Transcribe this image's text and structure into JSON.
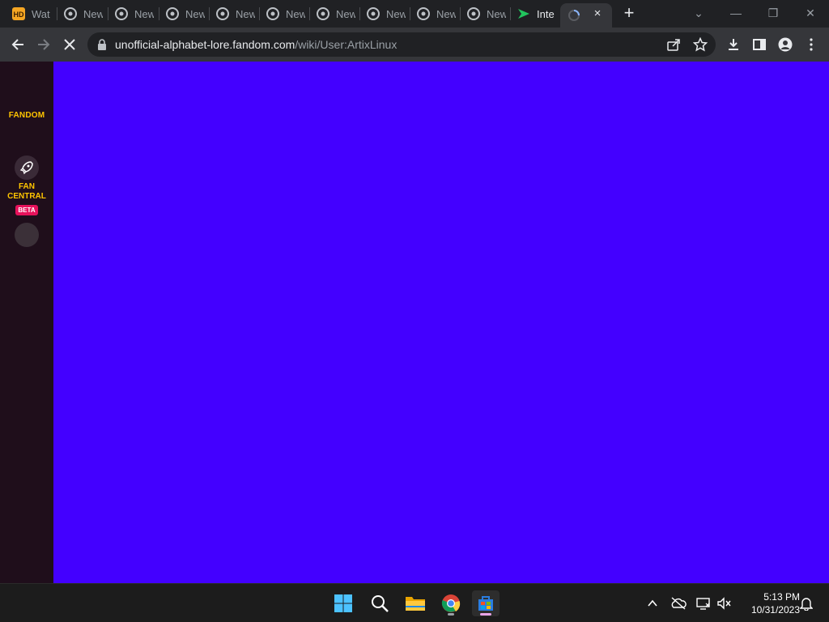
{
  "tabs": [
    {
      "label": "Wat",
      "icon": "hd-icon"
    },
    {
      "label": "New",
      "icon": "chrome-icon"
    },
    {
      "label": "New",
      "icon": "chrome-icon"
    },
    {
      "label": "New",
      "icon": "chrome-icon"
    },
    {
      "label": "New",
      "icon": "chrome-icon"
    },
    {
      "label": "New",
      "icon": "chrome-icon"
    },
    {
      "label": "New",
      "icon": "chrome-icon"
    },
    {
      "label": "New",
      "icon": "chrome-icon"
    },
    {
      "label": "New",
      "icon": "chrome-icon"
    },
    {
      "label": "New",
      "icon": "chrome-icon"
    },
    {
      "label": "Inte",
      "icon": "green-arrow-icon"
    }
  ],
  "active_tab": {
    "label": "",
    "icon": "loading-spinner-icon",
    "close": "×"
  },
  "new_tab_label": "+",
  "window_controls": {
    "dropdown": "⌄",
    "minimize": "—",
    "restore": "❐",
    "close": "✕"
  },
  "address": {
    "domain": "unofficial-alphabet-lore.fandom.com",
    "path": "/wiki/User:ArtixLinux"
  },
  "fandom": {
    "logo": "FANDOM",
    "fan_central_line1": "FAN",
    "fan_central_line2": "CENTRAL",
    "beta": "BETA"
  },
  "colors": {
    "page_background": "#4300ff",
    "rail_background": "#1f0e1b",
    "fandom_yellow": "#ffc500",
    "beta_pink": "#e6125b"
  },
  "taskbar": {
    "apps": [
      "windows-start-icon",
      "search-icon",
      "file-explorer-icon",
      "chrome-icon",
      "microsoft-store-icon"
    ]
  },
  "clock": {
    "time": "5:13 PM",
    "date": "10/31/2023"
  }
}
